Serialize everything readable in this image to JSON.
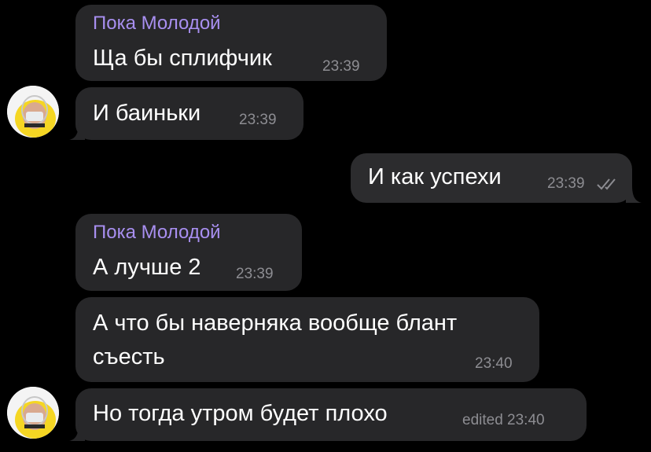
{
  "chat": {
    "messages": [
      {
        "sender": "Пока Молодой",
        "text": "Ща бы сплифчик",
        "time": "23:39"
      },
      {
        "text": "И баиньки",
        "time": "23:39"
      },
      {
        "text": "И как успехи",
        "time": "23:39",
        "status": "read-double-check-icon"
      },
      {
        "sender": "Пока Молодой",
        "text": "А лучше 2",
        "time": "23:39"
      },
      {
        "text_line1": "А что бы наверняка вообще блант",
        "text_line2": "съесть",
        "time": "23:40"
      },
      {
        "text": "Но тогда утром будет плохо",
        "time": "edited 23:40"
      }
    ]
  },
  "colors": {
    "background": "#000000",
    "bubble": "#272729",
    "sender_name": "#a88ff0",
    "timestamp": "#8d8d92",
    "avatar_hood": "#f5d623"
  }
}
